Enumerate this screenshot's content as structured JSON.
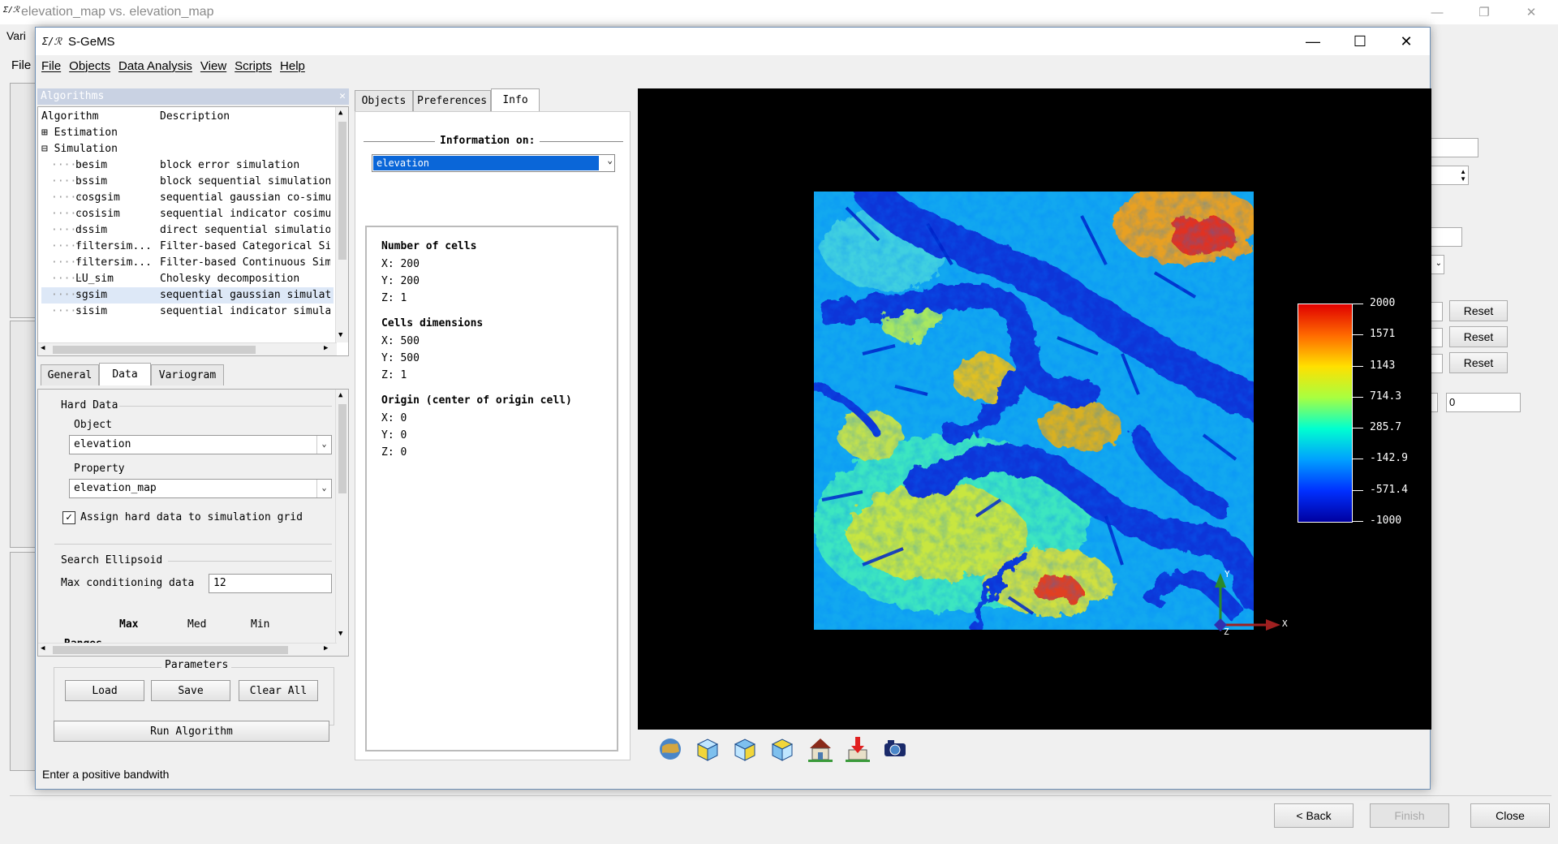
{
  "background_window": {
    "title": "elevation_map vs. elevation_map",
    "tab_label_partial": "Vari",
    "menu_file": "File",
    "reset_buttons": [
      "Reset",
      "Reset",
      "Reset"
    ],
    "value_field": "0",
    "nav": {
      "back": "< Back",
      "finish": "Finish",
      "close": "Close"
    }
  },
  "window": {
    "app_icon": "Σ/ℛ",
    "title": "S-GeMS"
  },
  "menu": [
    "File",
    "Objects",
    "Data Analysis",
    "View",
    "Scripts",
    "Help"
  ],
  "algorithms": {
    "panel_title": "Algorithms",
    "columns": [
      "Algorithm",
      "Description"
    ],
    "groups": [
      {
        "symbol": "⊞",
        "label": "Estimation"
      },
      {
        "symbol": "⊟",
        "label": "Simulation"
      }
    ],
    "items": [
      {
        "name": "besim",
        "desc": "block error simulation"
      },
      {
        "name": "bssim",
        "desc": "block sequential simulation"
      },
      {
        "name": "cosgsim",
        "desc": "sequential gaussian co-simul"
      },
      {
        "name": "cosisim",
        "desc": "sequential indicator cosimul"
      },
      {
        "name": "dssim",
        "desc": "direct sequential simulation"
      },
      {
        "name": "filtersim...",
        "desc": "Filter-based Categorical Sim"
      },
      {
        "name": "filtersim...",
        "desc": "Filter-based Continuous Simu"
      },
      {
        "name": "LU_sim",
        "desc": "Cholesky decomposition"
      },
      {
        "name": "sgsim",
        "desc": "sequential gaussian simulati"
      },
      {
        "name": "sisim",
        "desc": "sequential indicator simulat"
      }
    ]
  },
  "param_tabs": [
    "General",
    "Data",
    "Variogram"
  ],
  "data_tab": {
    "hard_data_title": "Hard Data",
    "object_label": "Object",
    "object_value": "elevation",
    "property_label": "Property",
    "property_value": "elevation_map",
    "assign_label": "Assign hard data to simulation grid",
    "search_title": "Search Ellipsoid",
    "max_cond_label": "Max conditioning data",
    "max_cond_value": "12",
    "ranges_cols": [
      "Max",
      "Med",
      "Min"
    ],
    "ranges_label": "Ranges"
  },
  "parameters": {
    "title": "Parameters",
    "load": "Load",
    "save": "Save",
    "clear": "Clear All",
    "run": "Run Algorithm"
  },
  "status": "Enter a positive bandwith",
  "mid_tabs": [
    "Objects",
    "Preferences",
    "Info"
  ],
  "info": {
    "info_on_label": "Information on:",
    "selected": "elevation",
    "num_cells_title": "Number of cells",
    "num_cells": [
      "X: 200",
      "Y: 200",
      "Z: 1"
    ],
    "cell_dims_title": "Cells dimensions",
    "cell_dims": [
      "X: 500",
      "Y: 500",
      "Z: 1"
    ],
    "origin_title": "Origin (center of origin cell)",
    "origin": [
      "X: 0",
      "Y: 0",
      "Z: 0"
    ]
  },
  "colorbar": {
    "labels": [
      "2000",
      "1571",
      "1143",
      "714.3",
      "285.7",
      "-142.9",
      "-571.4",
      "-1000"
    ],
    "max": 2000,
    "min": -1000
  },
  "axes": {
    "y": "Y",
    "z": "Z",
    "x": "X"
  },
  "viewer_icons": [
    "globe-icon",
    "cube-icon",
    "cube-front-icon",
    "cube-side-icon",
    "home-icon",
    "set-home-icon",
    "camera-icon"
  ]
}
